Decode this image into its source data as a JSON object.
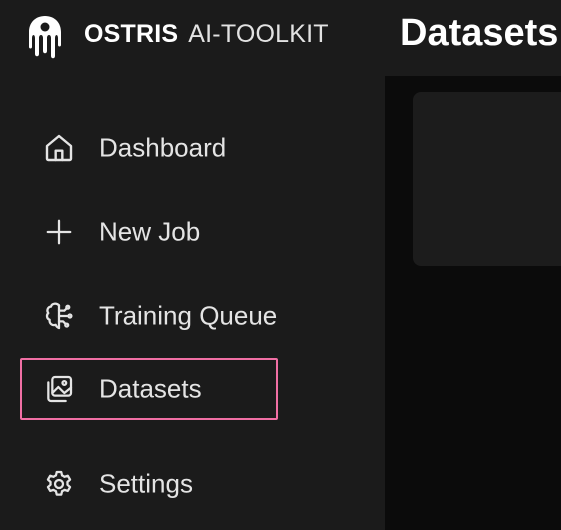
{
  "app": {
    "brand_strong": "OSTRIS",
    "brand_light": "AI-TOOLKIT"
  },
  "header": {
    "title": "Datasets"
  },
  "sidebar": {
    "items": [
      {
        "label": "Dashboard",
        "icon": "home-icon",
        "active": false
      },
      {
        "label": "New Job",
        "icon": "plus-icon",
        "active": false
      },
      {
        "label": "Training Queue",
        "icon": "brain-icon",
        "active": false
      },
      {
        "label": "Datasets",
        "icon": "images-icon",
        "active": true
      },
      {
        "label": "Settings",
        "icon": "gear-icon",
        "active": false
      }
    ]
  },
  "colors": {
    "background": "#1b1b1b",
    "main_background": "#0b0b0b",
    "card_background": "#1c1c1c",
    "active_outline": "#f06fa4",
    "text": "#e4e4e4"
  }
}
